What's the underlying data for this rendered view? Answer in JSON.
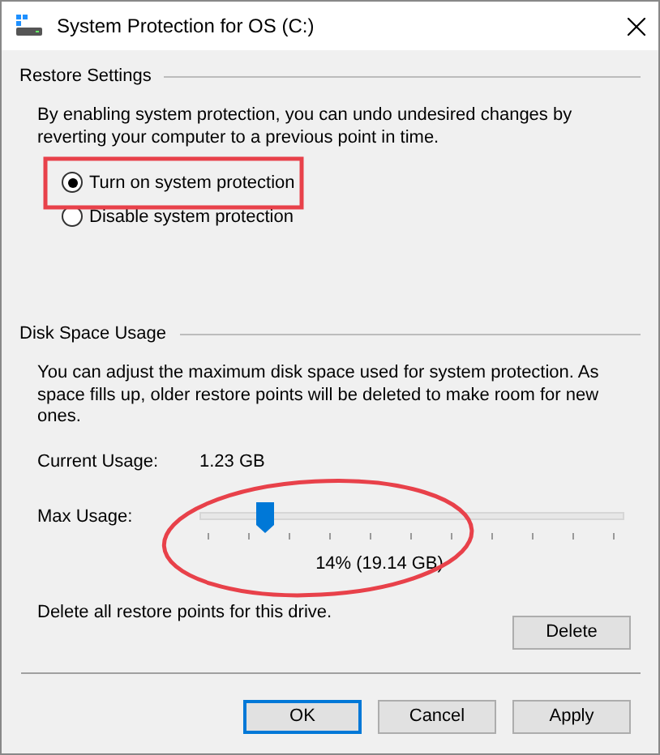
{
  "window": {
    "title": "System Protection for OS (C:)"
  },
  "restore_settings": {
    "heading": "Restore Settings",
    "description": "By enabling system protection, you can undo undesired changes by reverting your computer to a previous point in time.",
    "options": [
      {
        "label": "Turn on system protection",
        "selected": true
      },
      {
        "label": "Disable system protection",
        "selected": false
      }
    ]
  },
  "disk_space_usage": {
    "heading": "Disk Space Usage",
    "description": "You can adjust the maximum disk space used for system protection. As space fills up, older restore points will be deleted to make room for new ones.",
    "current_usage_label": "Current Usage:",
    "current_usage_value": "1.23 GB",
    "max_usage_label": "Max Usage:",
    "max_usage": {
      "level": 0.14,
      "reading": "14% (19.14 GB)"
    },
    "delete_text": "Delete all restore points for this drive.",
    "delete_button": "Delete"
  },
  "buttons": [
    {
      "label": "OK",
      "default": true
    },
    {
      "label": "Cancel",
      "default": false
    },
    {
      "label": "Apply",
      "default": false
    }
  ]
}
